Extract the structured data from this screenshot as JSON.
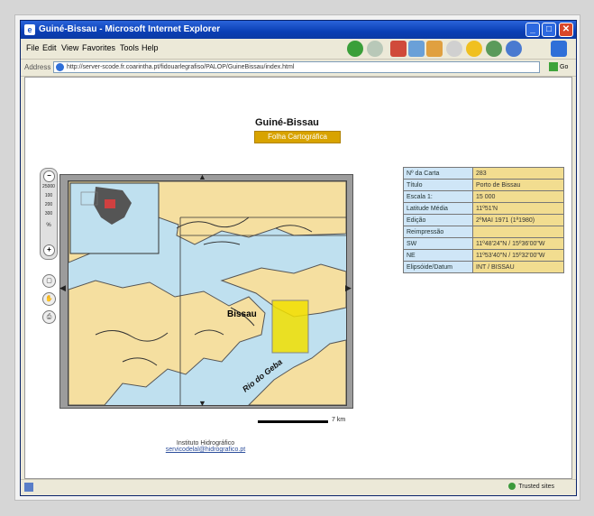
{
  "window": {
    "title": "Guiné-Bissau - Microsoft Internet Explorer",
    "buttons": {
      "minimize": "_",
      "maximize": "□",
      "close": "✕"
    }
  },
  "menu": [
    "File",
    "Edit",
    "View",
    "Favorites",
    "Tools",
    "Help"
  ],
  "address": {
    "label": "Address",
    "url": "http://server-scode.fr.coarintha.pt/fidouarlegrafiso/PALOP/GuineBissau/index.html",
    "go_label": "Go"
  },
  "status": {
    "zone": "Trusted sites"
  },
  "page": {
    "title": "Guiné-Bissau",
    "sheets_button": "Folha Cartográfica",
    "zoom_labels": [
      "25000",
      "100",
      "200",
      "300",
      "%"
    ],
    "zoom_in": "+",
    "zoom_out": "−",
    "map_labels": {
      "city": "Bissau",
      "river": "Rio do Geba"
    },
    "scale_text": "7 km",
    "footer_org": "Instituto Hidrográfico",
    "footer_link": "servicodelal@hidrografico.pt"
  },
  "info_table": [
    {
      "k": "Nº da Carta",
      "v": "283"
    },
    {
      "k": "Título",
      "v": "Porto de Bissau"
    },
    {
      "k": "Escala 1:",
      "v": "15 000"
    },
    {
      "k": "Latitude Média",
      "v": "11º51'N"
    },
    {
      "k": "Edição",
      "v": "2ºMAI 1971 (1ª1980)"
    },
    {
      "k": "Reimpressão",
      "v": ""
    },
    {
      "k": "SW",
      "v": "11º48'24\"N / 15º36'00\"W"
    },
    {
      "k": "NE",
      "v": "11º53'40\"N / 15º32'00\"W"
    },
    {
      "k": "Elipsóide/Datum",
      "v": "INT / BISSAU"
    }
  ],
  "colors": {
    "land": "#f5dfa0",
    "water": "#bfe0ef",
    "highlight": "#f2e000",
    "table_key": "#cfe6f7",
    "table_value": "#f2dd90",
    "button": "#d8a300"
  }
}
